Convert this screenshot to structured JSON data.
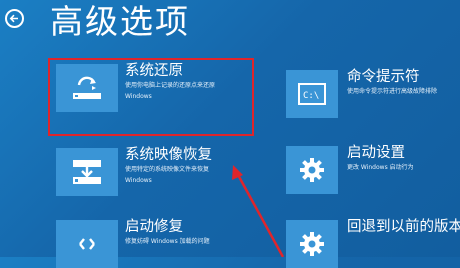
{
  "page": {
    "title": "高级选项"
  },
  "options": [
    {
      "label": "系统还原",
      "desc_line1": "使用你电脑上记录的还原点来还原",
      "desc_line2": "Windows",
      "icon": "system-restore-icon"
    },
    {
      "label": "系统映像恢复",
      "desc_line1": "使用特定的系统映像文件来恢复",
      "desc_line2": "Windows",
      "icon": "system-image-icon"
    },
    {
      "label": "启动修复",
      "desc_line1": "修复妨碍 Windows 加载的问题",
      "desc_line2": "",
      "icon": "startup-repair-icon"
    },
    {
      "label": "命令提示符",
      "desc_line1": "使用命令提示符进行高级故障排除",
      "desc_line2": "",
      "icon": "command-prompt-icon"
    },
    {
      "label": "启动设置",
      "desc_line1": "更改 Windows 启动行为",
      "desc_line2": "",
      "icon": "gear-icon"
    },
    {
      "label": "回退到以前的版本",
      "desc_line1": "",
      "desc_line2": "",
      "icon": "gear-icon"
    }
  ],
  "colors": {
    "background": "#1566aa",
    "tile": "#3a95d6",
    "highlight": "#e0252b"
  }
}
